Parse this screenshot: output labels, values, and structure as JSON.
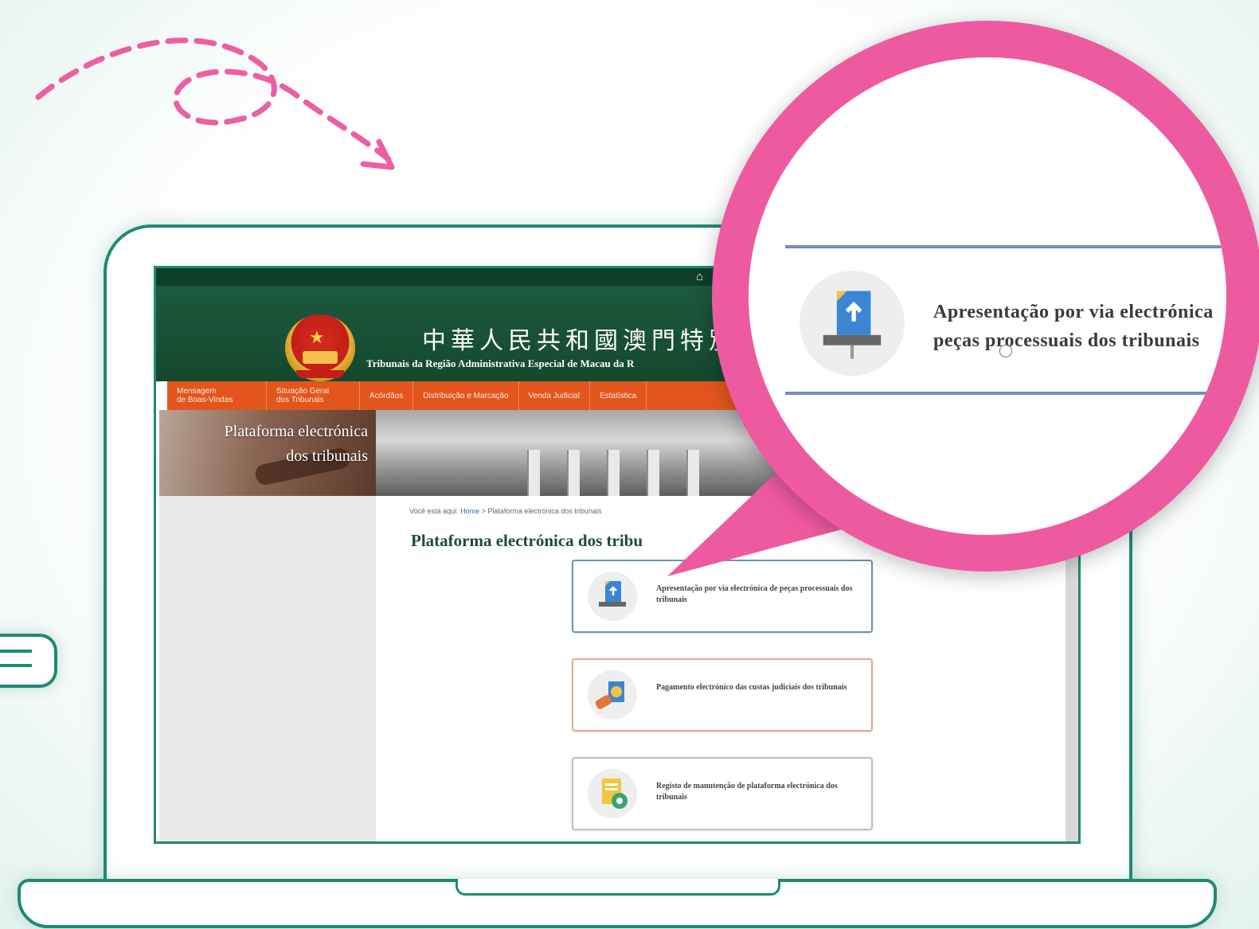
{
  "site": {
    "title_zh": "中華人民共和國澳門特別行",
    "title_pt": "Tribunais da Região Administrativa Especial de Macau da R"
  },
  "nav": {
    "items": [
      {
        "label": "Mensagem\nde Boas-Vindas"
      },
      {
        "label": "Situação Geral\ndos Tribunais"
      },
      {
        "label": "Acórdãos"
      },
      {
        "label": "Distribuição e Marcação"
      },
      {
        "label": "Venda Judicial"
      },
      {
        "label": "Estatística"
      }
    ]
  },
  "banner": {
    "title_line1": "Plataforma electrónica",
    "title_line2": "dos tribunais"
  },
  "breadcrumb": {
    "prefix": "Você está aqui:",
    "home": "Home",
    "separator": ">",
    "current": "Plataforma electrónica dos tribunais"
  },
  "main": {
    "page_title": "Plataforma electrónica dos tribu"
  },
  "services": [
    {
      "label": "Apresentação por via electrónica de peças processuais dos tribunais",
      "icon": "upload-document-icon",
      "border": "#6d8fbf"
    },
    {
      "label": "Pagamento electrónico das custas judiciais dos tribunais",
      "icon": "payment-icon",
      "border": "#e7a58f"
    },
    {
      "label": "Registo de manutenção de plataforma electrónica dos tribunais",
      "icon": "maintenance-icon",
      "border": "#b5c1c6"
    }
  ],
  "magnifier": {
    "line1": "Apresentação por via electrónica",
    "line2": "peças processuais dos tribunais"
  },
  "colors": {
    "accent_pink": "#ee5aa0",
    "frame_green": "#1e8a72",
    "header_green": "#1d5a3e",
    "nav_orange": "#e2561e"
  }
}
